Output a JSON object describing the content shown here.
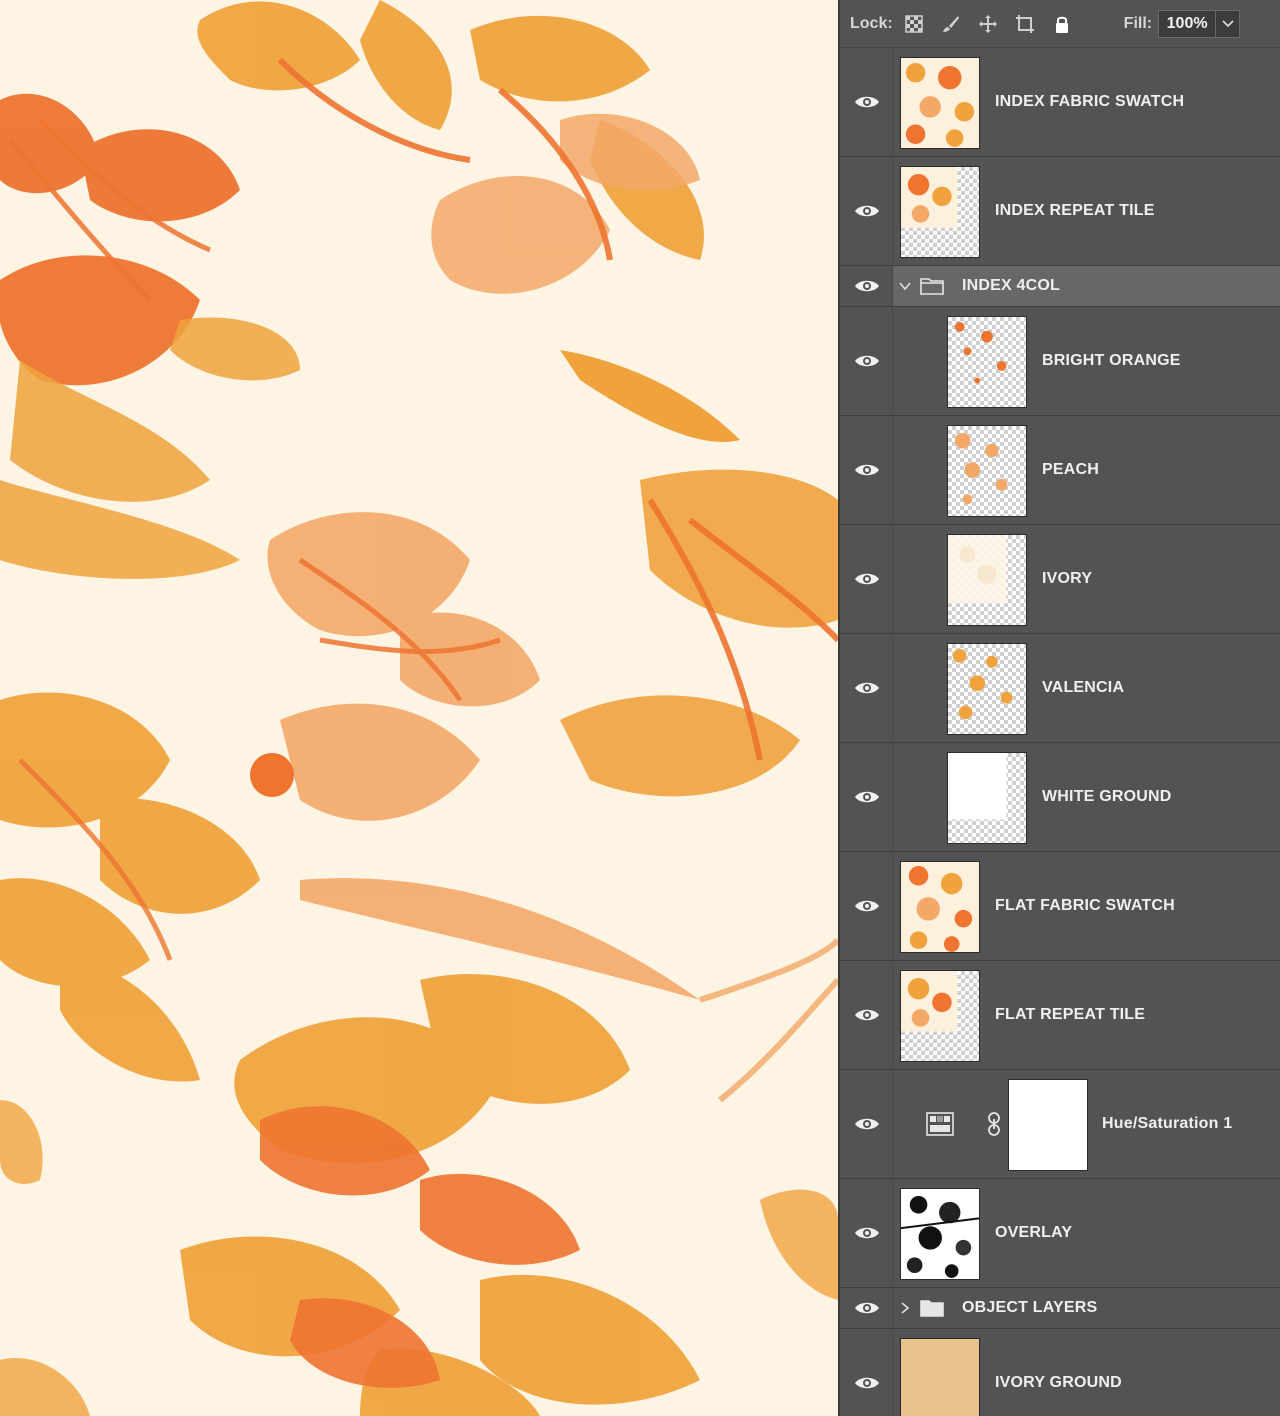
{
  "lock_bar": {
    "lock_label": "Lock:",
    "fill_label": "Fill:",
    "fill_value": "100%",
    "icons": [
      "lock-transparent-pixels-icon",
      "lock-image-pixels-icon",
      "lock-position-icon",
      "lock-artboard-icon",
      "lock-all-icon"
    ]
  },
  "colors": {
    "canvas_ground": "#fdf4e4",
    "bright_orange": "#ee7430",
    "peach": "#f3a868",
    "valencia": "#f0a33d",
    "ivory_ground": "#e9c38e",
    "panel_bg": "#535353"
  },
  "layers": [
    {
      "name": "INDEX FABRIC SWATCH",
      "visible": true
    },
    {
      "name": "INDEX REPEAT TILE",
      "visible": true
    },
    {
      "name": "INDEX 4COL",
      "visible": true,
      "type": "group",
      "expanded": true
    },
    {
      "name": "BRIGHT ORANGE",
      "visible": true
    },
    {
      "name": "PEACH",
      "visible": true
    },
    {
      "name": "IVORY",
      "visible": true
    },
    {
      "name": "VALENCIA",
      "visible": true
    },
    {
      "name": "WHITE GROUND",
      "visible": true
    },
    {
      "name": "FLAT FABRIC SWATCH",
      "visible": true
    },
    {
      "name": "FLAT REPEAT TILE",
      "visible": true
    },
    {
      "name": "Hue/Saturation 1",
      "visible": true,
      "type": "adjustment"
    },
    {
      "name": "OVERLAY",
      "visible": true
    },
    {
      "name": "OBJECT LAYERS",
      "visible": true,
      "type": "group",
      "expanded": false
    },
    {
      "name": "IVORY GROUND",
      "visible": true
    }
  ]
}
